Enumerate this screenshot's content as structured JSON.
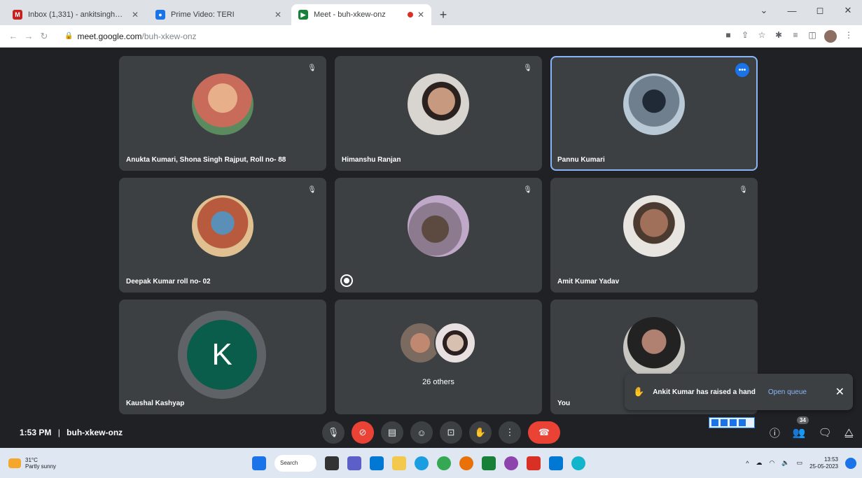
{
  "browser": {
    "tabs": [
      {
        "title": "Inbox (1,331) - ankitsingh@gmail.com",
        "favicon_color": "#c5221f",
        "active": false
      },
      {
        "title": "Prime Video: TERI",
        "favicon_color": "#1a73e8",
        "active": false
      },
      {
        "title": "Meet - buh-xkew-onz",
        "favicon_color": "#188038",
        "active": true
      }
    ],
    "new_tab": "+",
    "url_host": "meet.google.com",
    "url_path": "/buh-xkew-onz"
  },
  "tiles": [
    {
      "name": "Anukta Kumari, Shona Singh Rajput, Roll no- 88",
      "avatar_color": "#c86b5a"
    },
    {
      "name": "Himanshu Ranjan",
      "avatar_color": "#9e8878"
    },
    {
      "name": "Pannu Kumari",
      "avatar_color": "#6f7f8e"
    },
    {
      "name": "Deepak Kumar roll no- 02",
      "avatar_color": "#b85a3e"
    },
    {
      "name": "",
      "avatar_color": "#8c7b8f"
    },
    {
      "name": "Amit Kumar Yadav",
      "avatar_color": "#7a5b4a"
    },
    {
      "name": "Kaushal Kashyap",
      "letter": "K",
      "avatar_color": "#0b5d4b"
    },
    {
      "others": "26 others"
    },
    {
      "name": "You",
      "avatar_color": "#c8c6c0"
    }
  ],
  "notification": {
    "message": "Ankit Kumar has raised a hand",
    "action": "Open queue"
  },
  "meeting": {
    "time": "1:53 PM",
    "separator": "|",
    "code": "buh-xkew-onz",
    "participant_count": "34"
  },
  "taskbar": {
    "temp": "31°C",
    "weather": "Partly sunny",
    "search": "Search",
    "time": "13:53",
    "date": "25-05-2023"
  }
}
